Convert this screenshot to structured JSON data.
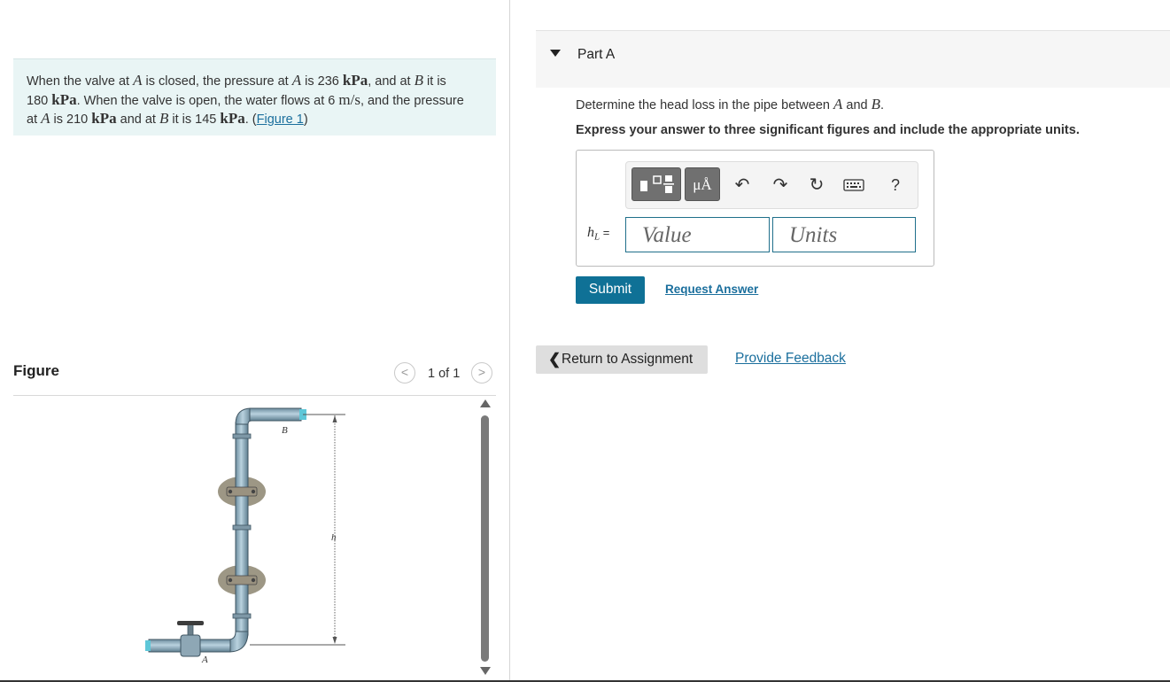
{
  "problem": {
    "text_parts": [
      "When the valve at ",
      "A",
      " is closed, the pressure at ",
      "A",
      " is 236 ",
      "kPa",
      ", and at ",
      "B",
      " it is ",
      "180 ",
      "kPa",
      ". When the valve is open, the water flows at 6 ",
      "m/s",
      ", and the pressure ",
      "at ",
      "A",
      " is 210 ",
      "kPa",
      " and at ",
      "B",
      " it is 145 ",
      "kPa",
      ". (",
      "Figure 1",
      ")"
    ]
  },
  "figure": {
    "title": "Figure",
    "page_indicator": "1 of 1",
    "prev_symbol": "<",
    "next_symbol": ">",
    "labels": {
      "top": "B",
      "bottom": "A",
      "height": "h"
    }
  },
  "part": {
    "title": "Part A",
    "question_parts": [
      "Determine the head loss in the pipe between ",
      "A",
      " and ",
      "B",
      "."
    ],
    "instructions": "Express your answer to three significant figures and include the appropriate units.",
    "toolbar": {
      "symbols_label": "μÅ",
      "undo_icon": "↶",
      "redo_icon": "↷",
      "reset_icon": "↻",
      "help_label": "?"
    },
    "answer_label_var": "h",
    "answer_label_sub": "L",
    "answer_label_eq": " =",
    "value_placeholder": "Value",
    "units_placeholder": "Units",
    "submit_label": "Submit",
    "request_answer_label": "Request Answer"
  },
  "footer": {
    "return_chevron": "❮",
    "return_label": "Return to Assignment",
    "feedback_label": "Provide Feedback"
  }
}
